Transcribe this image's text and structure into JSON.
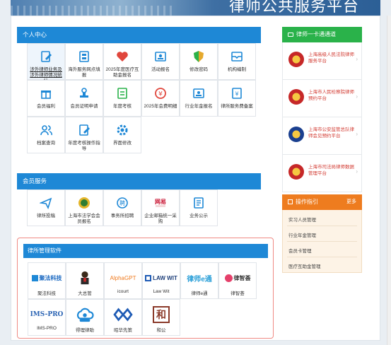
{
  "banner": {
    "title": "律师公共服务平台"
  },
  "personal": {
    "title": "个人中心",
    "tiles": [
      {
        "label": "涉外律师业务及涉外律师情况统计",
        "icon": "edit-document-icon",
        "color": "#1e88d6"
      },
      {
        "label": "海外服务网点填报",
        "icon": "grid-form-icon",
        "color": "#1e88d6"
      },
      {
        "label": "2025年度医疗互助金报名",
        "icon": "heart-icon",
        "color": "#e0463c"
      },
      {
        "label": "活动报名",
        "icon": "profile-card-icon",
        "color": "#1e88d6"
      },
      {
        "label": "修改密码",
        "icon": "shield-icon",
        "color": "#e5a92d"
      },
      {
        "label": "机构编制",
        "icon": "mail-box-icon",
        "color": "#1e88d6"
      },
      {
        "label": "会员福利",
        "icon": "gift-icon",
        "color": "#1e88d6"
      },
      {
        "label": "会员证明申请",
        "icon": "stamp-icon",
        "color": "#1e88d6"
      },
      {
        "label": "年度考核",
        "icon": "report-icon",
        "color": "#2ab24a"
      },
      {
        "label": "2025年会费明细",
        "icon": "yen-circle-icon",
        "color": "#e0463c"
      },
      {
        "label": "行业年金报名",
        "icon": "id-card-icon",
        "color": "#1e88d6"
      },
      {
        "label": "律所服务费备案",
        "icon": "yen-document-icon",
        "color": "#1e88d6"
      },
      {
        "label": "档案查询",
        "icon": "users-icon",
        "color": "#1e88d6"
      },
      {
        "label": "年度考核操作指导",
        "icon": "edit-guide-icon",
        "color": "#1e88d6"
      },
      {
        "label": "界面修改",
        "icon": "gear-icon",
        "color": "#1e88d6"
      }
    ]
  },
  "member": {
    "title": "会员服务",
    "tiles": [
      {
        "label": "律所投稿",
        "icon": "send-icon",
        "color": "#1e88d6"
      },
      {
        "label": "上海市法学会会员报名",
        "icon": "society-emblem-icon",
        "color": "#2e7d32"
      },
      {
        "label": "事务所招聘",
        "icon": "recruit-icon",
        "color": "#1e88d6"
      },
      {
        "label": "企业邮箱统一采购",
        "icon": "netease-mail-icon",
        "color": "#c8102e"
      },
      {
        "label": "业务公示",
        "icon": "notice-icon",
        "color": "#1e88d6"
      }
    ]
  },
  "software": {
    "title": "律所管理软件",
    "items": [
      {
        "label": "聚法科技",
        "logo_text": "聚法科技",
        "icon": "jufa-logo-icon"
      },
      {
        "label": "大总管",
        "logo_text": "",
        "icon": "butler-logo-icon"
      },
      {
        "label": "icourt",
        "logo_text": "AlphaGPT",
        "icon": "alphagpt-logo-icon"
      },
      {
        "label": "Law Wit",
        "logo_text": "LAW WIT",
        "icon": "lawwit-logo-icon"
      },
      {
        "label": "律师e通",
        "logo_text": "律师e通",
        "icon": "lawyer-etong-logo-icon"
      },
      {
        "label": "律智荟",
        "logo_text": "律智荟",
        "icon": "lvzhihui-logo-icon"
      },
      {
        "label": "IMS-PRO",
        "logo_text": "IMS-PRO",
        "icon": "ims-pro-logo-icon"
      },
      {
        "label": "得理律助",
        "logo_text": "",
        "icon": "deli-cloud-logo-icon"
      },
      {
        "label": "昭华先策",
        "logo_text": "",
        "icon": "zhaohua-logo-icon"
      },
      {
        "label": "和公",
        "logo_text": "和",
        "icon": "hegong-logo-icon"
      }
    ]
  },
  "sidebar": {
    "card_title": "律师一卡通通道",
    "links": [
      {
        "label": "上海高级人民法院律师服务平台",
        "icon": "court-emblem-icon"
      },
      {
        "label": "上海市人民检察院律师预约平台",
        "icon": "procuratorate-emblem-icon"
      },
      {
        "label": "上海市公安监管总队律师会见预约平台",
        "icon": "police-emblem-icon"
      },
      {
        "label": "上海市司法局律师数据管理平台",
        "icon": "justice-emblem-icon"
      }
    ],
    "guide_title": "操作指引",
    "guide_more": "更多",
    "guide_items": [
      "实习人员管理",
      "行业年金管理",
      "会员卡管理",
      "医疗互助金管理"
    ]
  },
  "colors": {
    "primary": "#1e88d6",
    "green": "#2ab24a",
    "orange": "#ee7c1f",
    "red_text": "#d23a31",
    "highlight_border": "#ef8a84"
  }
}
